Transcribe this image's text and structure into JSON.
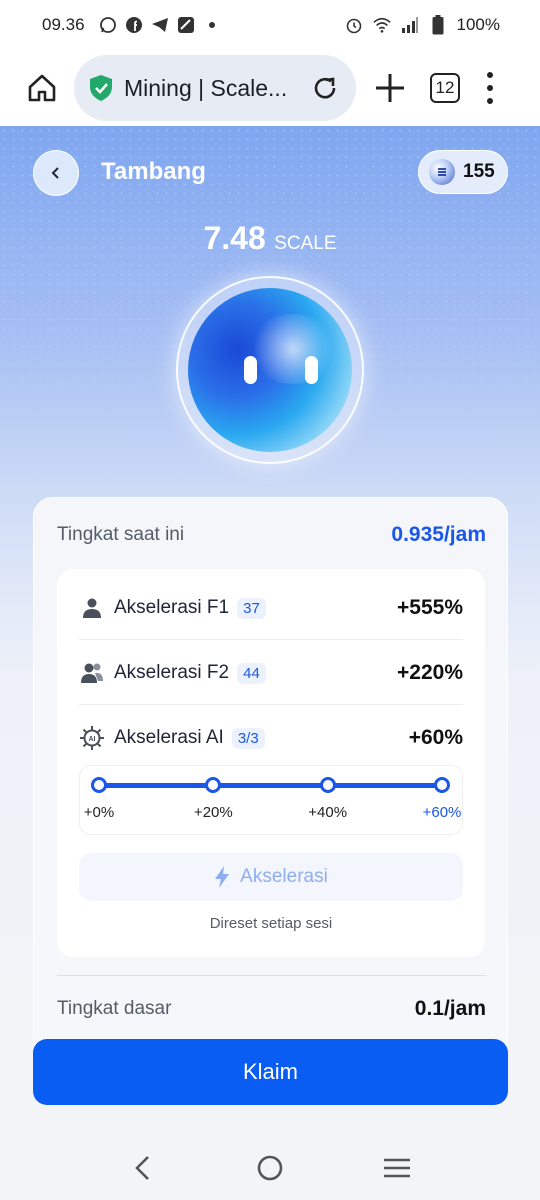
{
  "status_bar": {
    "time": "09.36",
    "battery": "100%",
    "left_icons": [
      "whatsapp-icon",
      "facebook-icon",
      "telegram-icon",
      "gallery-icon",
      "dot-icon"
    ],
    "right_icons": [
      "alarm-icon",
      "wifi-icon",
      "signal-icon",
      "battery-icon"
    ]
  },
  "browser": {
    "url_title": "Mining | Scale...",
    "tab_count": "12"
  },
  "header": {
    "title": "Tambang",
    "balance": "155"
  },
  "mining": {
    "amount": "7.48",
    "unit": "SCALE"
  },
  "rates": {
    "current_label": "Tingkat saat ini",
    "current_value": "0.935/jam",
    "base_label": "Tingkat dasar",
    "base_value": "0.1/jam"
  },
  "accelerations": [
    {
      "name": "Akselerasi F1",
      "badge": "37",
      "percent": "+555%",
      "icon": "person-icon"
    },
    {
      "name": "Akselerasi F2",
      "badge": "44",
      "percent": "+220%",
      "icon": "people-icon"
    },
    {
      "name": "Akselerasi AI",
      "badge": "3/3",
      "percent": "+60%",
      "icon": "ai-chip-icon"
    }
  ],
  "ai_levels": {
    "labels": [
      "+0%",
      "+20%",
      "+40%",
      "+60%"
    ],
    "current_index": 3,
    "progress": 1.0
  },
  "accelerate_button": "Akselerasi",
  "reset_note": "Direset setiap sesi",
  "claim_button": "Klaim",
  "colors": {
    "accent": "#1a57e8",
    "claim": "#0a5df2",
    "secure": "#22a86a"
  }
}
